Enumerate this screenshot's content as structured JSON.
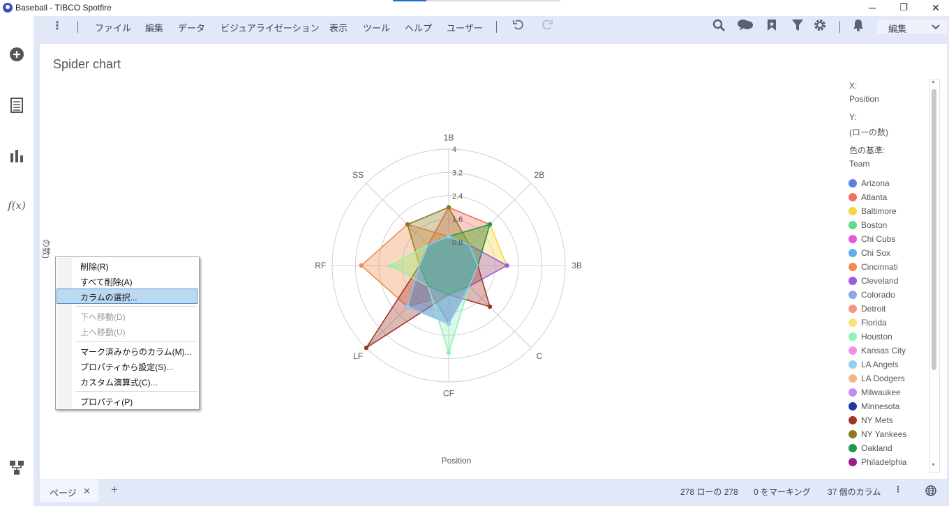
{
  "window": {
    "title": "Baseball - TIBCO Spotfire",
    "controls": {
      "minimize": "─",
      "restore": "❐",
      "close": "✕"
    }
  },
  "menubar": {
    "items": [
      "ファイル",
      "編集",
      "データ",
      "ビジュアライゼーション",
      "表示",
      "ツール",
      "ヘルプ",
      "ユーザー"
    ],
    "mode": "編集"
  },
  "viz": {
    "title": "Spider chart",
    "y_axis_fragment": "の数)"
  },
  "legend": {
    "x_label": "X:",
    "x_value": "Position",
    "y_label": "Y:",
    "y_value": "(ローの数)",
    "color_label": "色の基準:",
    "color_value": "Team",
    "teams": [
      {
        "name": "Arizona",
        "color": "#5b7ee8"
      },
      {
        "name": "Atlanta",
        "color": "#f07060"
      },
      {
        "name": "Baltimore",
        "color": "#f5d742"
      },
      {
        "name": "Boston",
        "color": "#5ddc8c"
      },
      {
        "name": "Chi Cubs",
        "color": "#e45ad8"
      },
      {
        "name": "Chi Sox",
        "color": "#5bb0ea"
      },
      {
        "name": "Cincinnati",
        "color": "#f28c4e"
      },
      {
        "name": "Cleveland",
        "color": "#a05ae0"
      },
      {
        "name": "Colorado",
        "color": "#8fa6ea"
      },
      {
        "name": "Detroit",
        "color": "#f4958b"
      },
      {
        "name": "Florida",
        "color": "#f8e27a"
      },
      {
        "name": "Houston",
        "color": "#8ff2b8"
      },
      {
        "name": "Kansas City",
        "color": "#f08ee6"
      },
      {
        "name": "LA Angels",
        "color": "#93cdf2"
      },
      {
        "name": "LA Dodgers",
        "color": "#f6b486"
      },
      {
        "name": "Milwaukee",
        "color": "#c08ef0"
      },
      {
        "name": "Minnesota",
        "color": "#1e3a9e"
      },
      {
        "name": "NY Mets",
        "color": "#a0352a"
      },
      {
        "name": "NY Yankees",
        "color": "#8e7a22"
      },
      {
        "name": "Oakland",
        "color": "#1e9a4e"
      },
      {
        "name": "Philadelphia",
        "color": "#9a1e8a"
      }
    ]
  },
  "context_menu": {
    "items": [
      {
        "label": "削除(R)",
        "enabled": true
      },
      {
        "label": "すべて削除(A)",
        "enabled": true
      },
      {
        "label": "カラムの選択...",
        "enabled": true,
        "highlighted": true
      },
      {
        "label": "下へ移動(D)",
        "enabled": false
      },
      {
        "label": "上へ移動(U)",
        "enabled": false
      },
      {
        "label": "マーク済みからのカラム(M)...",
        "enabled": true
      },
      {
        "label": "プロパティから設定(S)...",
        "enabled": true
      },
      {
        "label": "カスタム演算式(C)...",
        "enabled": true
      },
      {
        "label": "プロパティ(P)",
        "enabled": true
      }
    ]
  },
  "statusbar": {
    "page_tab": "ページ",
    "rows": "278 ローの 278",
    "marked": "0 をマーキング",
    "columns": "37 個のカラム"
  },
  "chart_data": {
    "type": "radar",
    "title": "",
    "xlabel": "Position",
    "axes": [
      "1B",
      "2B",
      "3B",
      "C",
      "CF",
      "LF",
      "RF",
      "SS"
    ],
    "radial_ticks": [
      "0.8",
      "1.6",
      "2.4",
      "3.2",
      "4"
    ],
    "rlim": [
      0,
      4
    ],
    "series": [
      {
        "name": "Atlanta",
        "color": "#f07060",
        "values": [
          2,
          2,
          1,
          1,
          1,
          2,
          1,
          1
        ]
      },
      {
        "name": "Cincinnati",
        "color": "#f28c4e",
        "values": [
          1,
          1,
          1,
          1,
          1,
          2,
          3,
          2
        ]
      },
      {
        "name": "NY Yankees",
        "color": "#8e7a22",
        "values": [
          2,
          1,
          1,
          1,
          1,
          1,
          1,
          2
        ]
      },
      {
        "name": "Baltimore",
        "color": "#f5d742",
        "values": [
          1,
          2,
          2,
          1,
          1,
          1,
          2,
          1
        ]
      },
      {
        "name": "Cleveland",
        "color": "#a05ae0",
        "values": [
          1,
          1,
          2,
          1,
          2,
          1,
          1,
          1
        ]
      },
      {
        "name": "NY Mets",
        "color": "#a0352a",
        "values": [
          1,
          1,
          1,
          2,
          1,
          4,
          1,
          1
        ]
      },
      {
        "name": "Minnesota",
        "color": "#1e3a9e",
        "values": [
          1,
          1,
          1,
          1,
          2,
          2,
          1,
          1
        ]
      },
      {
        "name": "Houston",
        "color": "#8ff2b8",
        "values": [
          1,
          1,
          1,
          1,
          3,
          1,
          2,
          1
        ]
      },
      {
        "name": "Oakland",
        "color": "#1e9a4e",
        "values": [
          1,
          2,
          1,
          1,
          1,
          1,
          1,
          1
        ]
      },
      {
        "name": "LA Angels",
        "color": "#93cdf2",
        "values": [
          1,
          1,
          1,
          1,
          2,
          2,
          1,
          1
        ]
      }
    ]
  }
}
